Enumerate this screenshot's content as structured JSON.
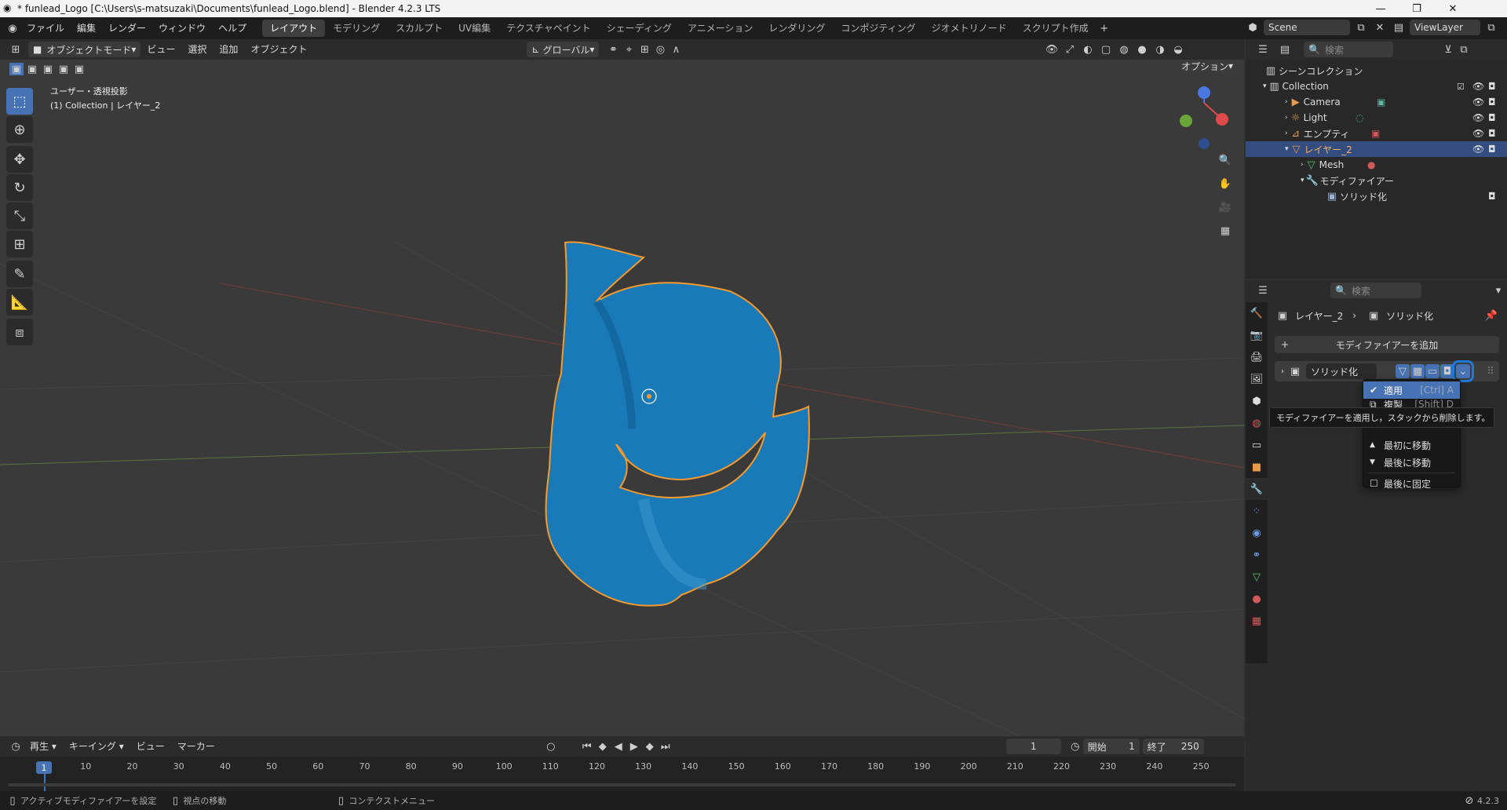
{
  "window": {
    "title": "* funlead_Logo [C:\\Users\\s-matsuzaki\\Documents\\funlead_Logo.blend] - Blender 4.2.3 LTS"
  },
  "menus": [
    "ファイル",
    "編集",
    "レンダー",
    "ウィンドウ",
    "ヘルプ"
  ],
  "workspaces": [
    "レイアウト",
    "モデリング",
    "スカルプト",
    "UV編集",
    "テクスチャペイント",
    "シェーディング",
    "アニメーション",
    "レンダリング",
    "コンポジティング",
    "ジオメトリノード",
    "スクリプト作成"
  ],
  "scene": {
    "name": "Scene",
    "view_layer": "ViewLayer"
  },
  "viewport_header": {
    "mode": "オブジェクトモード",
    "view": "ビュー",
    "select": "選択",
    "add": "追加",
    "object": "オブジェクト",
    "transform": "グローバル",
    "options": "オプション"
  },
  "viewport_info": {
    "line1": "ユーザー・透視投影",
    "line2": "(1) Collection | レイヤー_2"
  },
  "outliner": {
    "search_placeholder": "検索",
    "scene_collection": "シーンコレクション",
    "collection": "Collection",
    "items": [
      "Camera",
      "Light",
      "エンプティ",
      "レイヤー_2",
      "Mesh",
      "モディファイアー",
      "ソリッド化"
    ]
  },
  "properties": {
    "search_placeholder": "検索",
    "breadcrumb_obj": "レイヤー_2",
    "breadcrumb_mod": "ソリッド化",
    "add_modifier": "モディファイアーを追加",
    "modifier_name": "ソリッド化"
  },
  "context_menu": {
    "apply": "適用",
    "apply_shortcut": "[Ctrl] A",
    "duplicate": "複製",
    "duplicate_shortcut": "[Shift] D",
    "move_first": "最初に移動",
    "move_last": "最後に移動",
    "pin_last": "最後に固定"
  },
  "tooltip": "モディファイアーを適用し，スタックから削除します。",
  "timeline": {
    "play": "再生",
    "keying": "キーイング",
    "view": "ビュー",
    "marker": "マーカー",
    "current_frame": "1",
    "start_label": "開始",
    "start": "1",
    "end_label": "終了",
    "end": "250",
    "ticks": [
      "1",
      "10",
      "20",
      "30",
      "40",
      "50",
      "60",
      "70",
      "80",
      "90",
      "100",
      "110",
      "120",
      "130",
      "140",
      "150",
      "160",
      "170",
      "180",
      "190",
      "200",
      "210",
      "220",
      "230",
      "240",
      "250"
    ]
  },
  "status": {
    "left": "アクティブモディファイアーを設定",
    "mid": "視点の移動",
    "right": "コンテクストメニュー",
    "version": "4.2.3"
  },
  "colors": {
    "accent": "#4772b3",
    "object_blue": "#1a7ab8",
    "selection_orange": "#f59a2e"
  }
}
